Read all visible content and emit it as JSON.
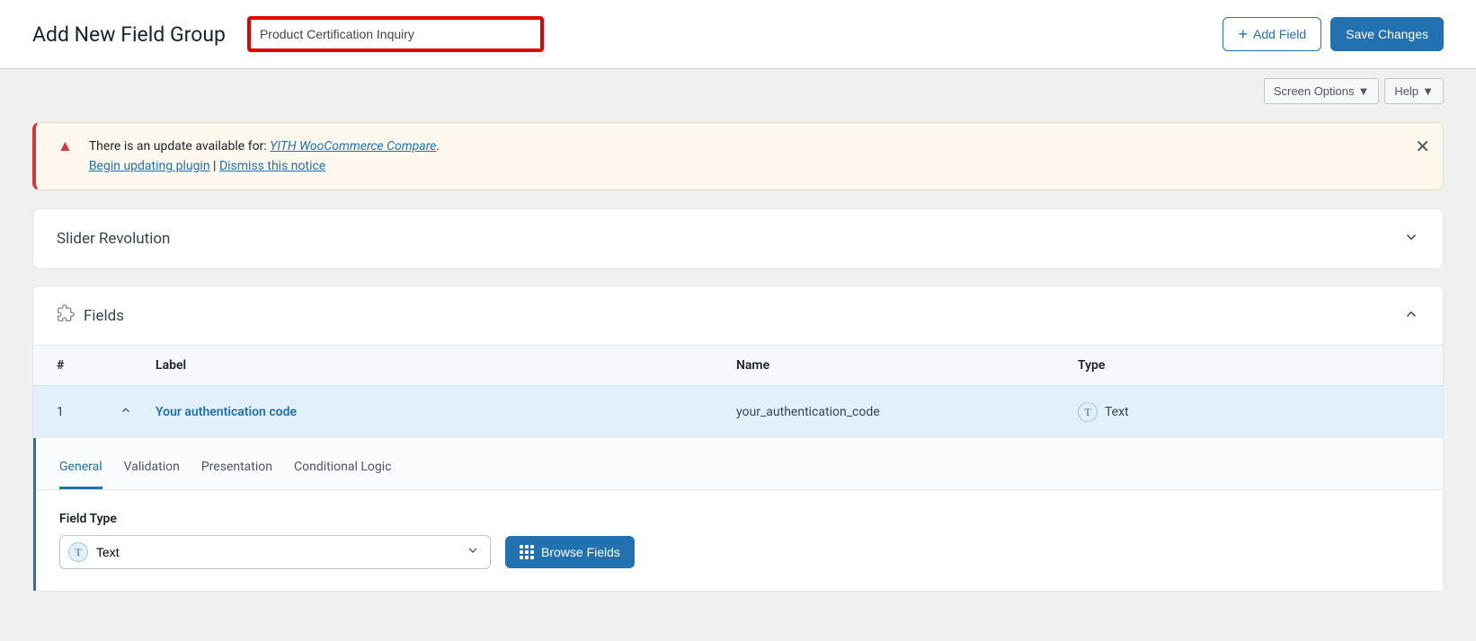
{
  "header": {
    "page_title": "Add New Field Group",
    "title_value": "Product Certification Inquiry",
    "add_field_label": "Add Field",
    "save_label": "Save Changes"
  },
  "subbar": {
    "screen_options": "Screen Options",
    "help": "Help"
  },
  "notice": {
    "text_prefix": "There is an update available for: ",
    "plugin_name": "YITH WooCommerce Compare",
    "text_suffix": ".",
    "begin_update": "Begin updating plugin",
    "separator": " | ",
    "dismiss": "Dismiss this notice"
  },
  "panels": {
    "slider": "Slider Revolution",
    "fields": "Fields"
  },
  "table": {
    "col_num": "#",
    "col_label": "Label",
    "col_name": "Name",
    "col_type": "Type"
  },
  "row": {
    "num": "1",
    "label": "Your authentication code",
    "name": "your_authentication_code",
    "type": "Text",
    "type_badge": "T"
  },
  "tabs": {
    "general": "General",
    "validation": "Validation",
    "presentation": "Presentation",
    "conditional": "Conditional Logic"
  },
  "settings": {
    "field_type_label": "Field Type",
    "field_type_value": "Text",
    "browse_label": "Browse Fields"
  }
}
